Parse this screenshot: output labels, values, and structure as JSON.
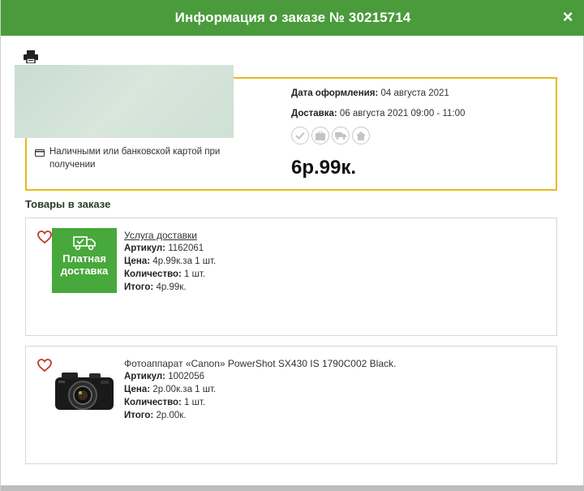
{
  "header": {
    "title": "Информация о заказе № 30215714",
    "close_icon": "×"
  },
  "toolbar": {
    "print_icon": "printer-icon"
  },
  "order": {
    "payment_method": "Наличными или банковской картой при получении",
    "date_label": "Дата оформления:",
    "date_value": " 04 августа 2021",
    "delivery_label": "Доставка:",
    "delivery_value": " 06 августа 2021 09:00 - 11:00",
    "status_icons": [
      "check-icon",
      "package-icon",
      "truck-icon",
      "home-icon"
    ],
    "total": "6р.99к."
  },
  "items_section": {
    "title": "Товары в заказе"
  },
  "items": [
    {
      "name": "Услуга доставки",
      "thumb_text": "Платная доставка",
      "sku_label": "Артикул:",
      "sku": " 1162061",
      "price_label": "Цена:",
      "price": " 4р.99к.за 1 шт.",
      "qty_label": "Количество:",
      "qty": " 1 шт.",
      "total_label": "Итого:",
      "total": " 4р.99к."
    },
    {
      "name": "Фотоаппарат «Canon» PowerShot SX430 IS 1790C002 Black.",
      "sku_label": "Артикул:",
      "sku": " 1002056",
      "price_label": "Цена:",
      "price": " 2р.00к.за 1 шт.",
      "qty_label": "Количество:",
      "qty": " 1 шт.",
      "total_label": "Итого:",
      "total": " 2р.00к."
    }
  ],
  "colors": {
    "header_bg": "#4a9b3c",
    "order_border": "#e8b91a",
    "delivery_thumb_bg": "#47a83b",
    "fav_icon": "#c0392b"
  }
}
